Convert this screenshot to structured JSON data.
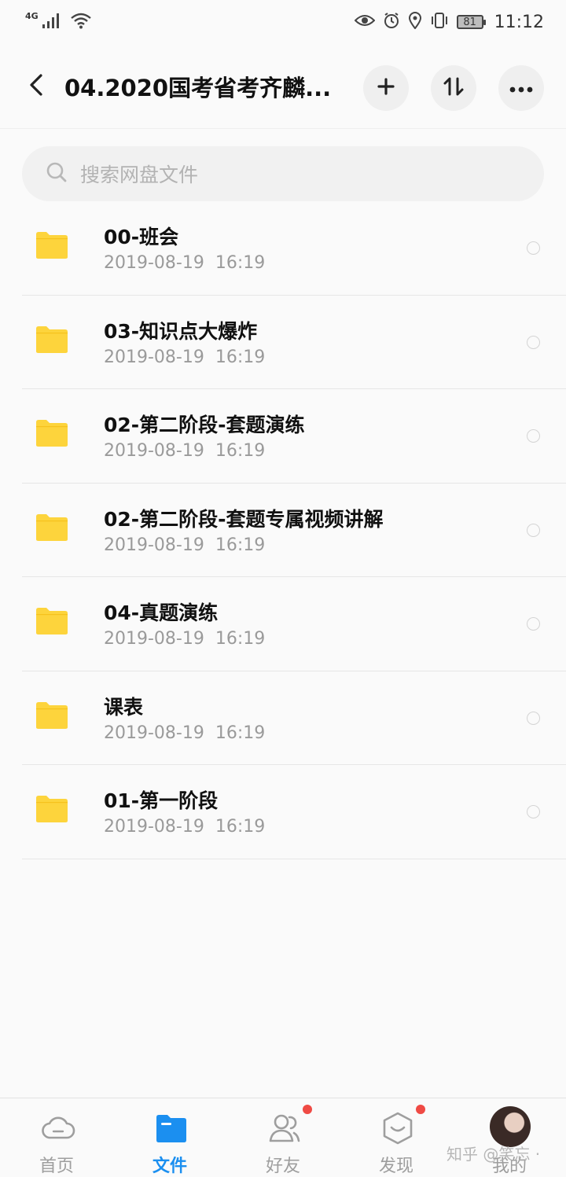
{
  "status_bar": {
    "network_type": "4G",
    "battery": "81",
    "time": "11:12"
  },
  "header": {
    "title": "04.2020国考省考齐麟...",
    "back_icon": "chevron-left-icon",
    "add_icon": "plus-icon",
    "sort_icon": "sort-icon",
    "more_icon": "more-horizontal-icon"
  },
  "search": {
    "placeholder": "搜索网盘文件",
    "icon": "search-icon"
  },
  "files": [
    {
      "name": "00-班会",
      "date": "2019-08-19  16:19"
    },
    {
      "name": "03-知识点大爆炸",
      "date": "2019-08-19  16:19"
    },
    {
      "name": "02-第二阶段-套题演练",
      "date": "2019-08-19  16:19"
    },
    {
      "name": "02-第二阶段-套题专属视频讲解",
      "date": "2019-08-19  16:19"
    },
    {
      "name": "04-真题演练",
      "date": "2019-08-19  16:19"
    },
    {
      "name": "课表",
      "date": "2019-08-19  16:19"
    },
    {
      "name": "01-第一阶段",
      "date": "2019-08-19  16:19"
    }
  ],
  "nav": {
    "home": "首页",
    "files": "文件",
    "friends": "好友",
    "discover": "发现",
    "mine": "我的"
  },
  "watermark": "知乎 @笑忘 ·",
  "colors": {
    "accent": "#1b8ff0",
    "folder": "#fdd43c",
    "badge": "#ef4a44"
  }
}
